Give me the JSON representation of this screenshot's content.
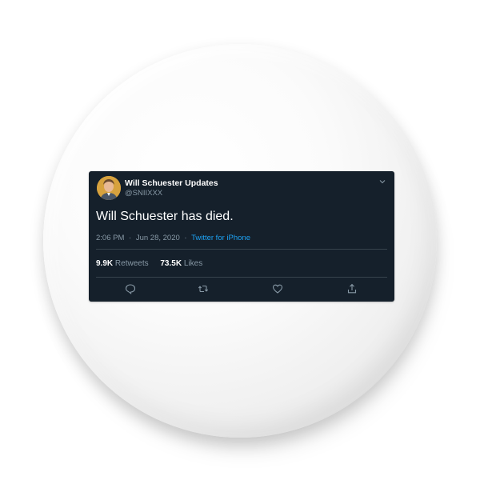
{
  "tweet": {
    "display_name": "Will Schuester Updates",
    "handle": "@SNIIXXX",
    "text": "Will Schuester has died.",
    "time": "2:06 PM",
    "date": "Jun 28, 2020",
    "separator": "·",
    "source": "Twitter for iPhone",
    "stats": {
      "retweets_count": "9.9K",
      "retweets_label": "Retweets",
      "likes_count": "73.5K",
      "likes_label": "Likes"
    }
  },
  "icons": {
    "more": "chevron-down-icon",
    "reply": "reply-icon",
    "retweet": "retweet-icon",
    "like": "heart-icon",
    "share": "share-icon"
  },
  "colors": {
    "tweet_background": "#15202b",
    "secondary_text": "#8899a6",
    "link": "#1da1f2",
    "divider": "#38444d"
  }
}
